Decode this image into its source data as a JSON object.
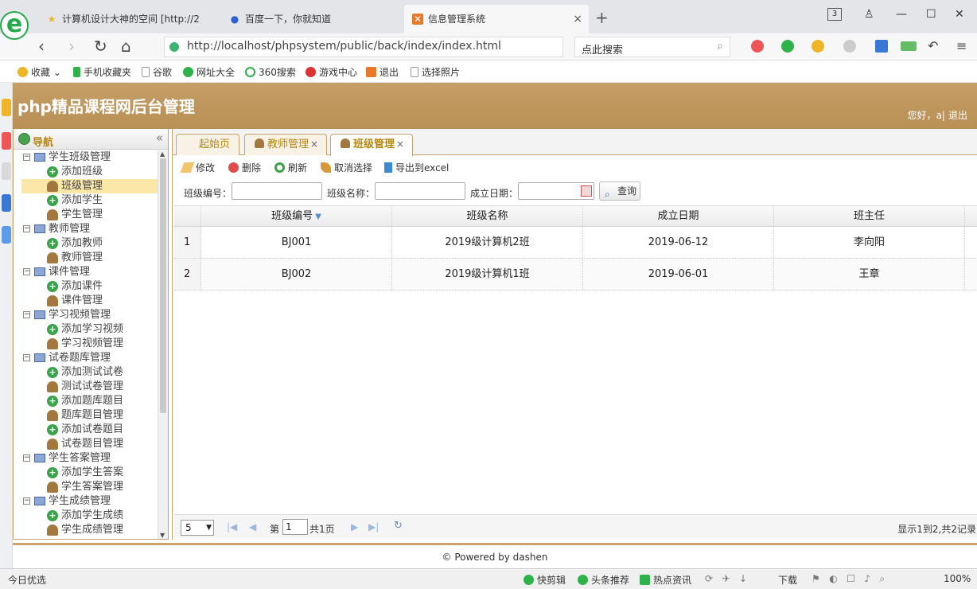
{
  "browser": {
    "tabs": [
      {
        "label": "计算机设计大神的空间 [http://2",
        "icon": "star-icon"
      },
      {
        "label": "百度一下，你就知道",
        "icon": "paw-icon"
      },
      {
        "label": "信息管理系统",
        "icon": "app-icon"
      }
    ],
    "tab_count": "3",
    "url": "http://localhost/phpsystem/public/back/index/index.html",
    "search_placeholder": "点此搜索",
    "bookmarks": [
      "收藏",
      "手机收藏夹",
      "谷歌",
      "网址大全",
      "360搜索",
      "游戏中心",
      "退出",
      "选择照片"
    ]
  },
  "app": {
    "title": "php精品课程网后台管理",
    "greeting": "您好，a|",
    "logout": "退出",
    "nav_title": "导航",
    "tree": [
      {
        "label": "学生班级管理",
        "items": [
          "添加班级",
          "班级管理",
          "添加学生",
          "学生管理"
        ]
      },
      {
        "label": "教师管理",
        "items": [
          "添加教师",
          "教师管理"
        ]
      },
      {
        "label": "课件管理",
        "items": [
          "添加课件",
          "课件管理"
        ]
      },
      {
        "label": "学习视频管理",
        "items": [
          "添加学习视频",
          "学习视频管理"
        ]
      },
      {
        "label": "试卷题库管理",
        "items": [
          "添加测试试卷",
          "测试试卷管理",
          "添加题库题目",
          "题库题目管理",
          "添加试卷题目",
          "试卷题目管理"
        ]
      },
      {
        "label": "学生答案管理",
        "items": [
          "添加学生答案",
          "学生答案管理"
        ]
      },
      {
        "label": "学生成绩管理",
        "items": [
          "添加学生成绩",
          "学生成绩管理"
        ]
      }
    ],
    "page_tabs": [
      "起始页",
      "教师管理",
      "班级管理"
    ],
    "toolbar": {
      "edit": "修改",
      "delete": "删除",
      "refresh": "刷新",
      "deselect": "取消选择",
      "export": "导出到excel"
    },
    "search": {
      "class_no": "班级编号：",
      "class_name": "班级名称：",
      "date": "成立日期：",
      "query": "查询"
    },
    "grid": {
      "columns": [
        "班级编号",
        "班级名称",
        "成立日期",
        "班主任"
      ],
      "rows": [
        {
          "num": "1",
          "no": "BJ001",
          "name": "2019级计算机2班",
          "date": "2019-06-12",
          "teacher": "李向阳"
        },
        {
          "num": "2",
          "no": "BJ002",
          "name": "2019级计算机1班",
          "date": "2019-06-01",
          "teacher": "王章"
        }
      ]
    },
    "pager": {
      "page_size": "5",
      "page_prefix": "第",
      "page": "1",
      "page_total": "共1页",
      "info": "显示1到2,共2记录"
    },
    "footer": "© Powered by dashen"
  },
  "status": {
    "items": [
      "今日优选",
      "快剪辑",
      "头条推荐",
      "热点资讯",
      "下载",
      "100%"
    ]
  }
}
